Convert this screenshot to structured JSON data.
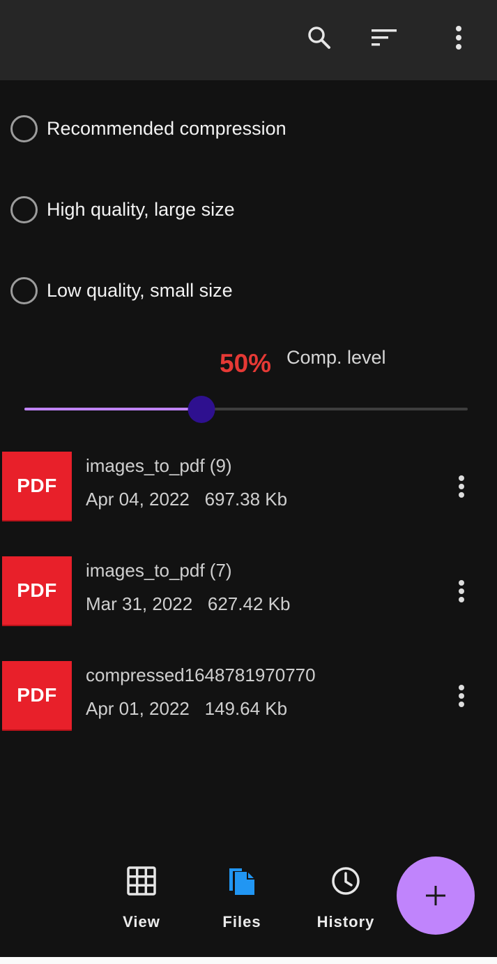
{
  "colors": {
    "accent": "#c084fc",
    "slider_thumb": "#2e108f",
    "percent_red": "#e53935",
    "pdf_red": "#e8202a",
    "files_blue": "#2196f3"
  },
  "toolbar": {
    "icons": [
      "search-icon",
      "sort-icon",
      "more-vert-icon"
    ]
  },
  "compression": {
    "options": [
      {
        "label": "Recommended compression",
        "selected": false
      },
      {
        "label": "High quality, large size",
        "selected": false
      },
      {
        "label": "Low quality, small size",
        "selected": false
      }
    ],
    "percent_text": "50%",
    "level_label": "Comp. level",
    "slider_value": 0.4
  },
  "files": [
    {
      "thumb_label": "PDF",
      "name": "images_to_pdf (9)",
      "date": "Apr 04, 2022",
      "size": "697.38 Kb"
    },
    {
      "thumb_label": "PDF",
      "name": "images_to_pdf (7)",
      "date": "Mar 31, 2022",
      "size": "627.42 Kb"
    },
    {
      "thumb_label": "PDF",
      "name": "compressed1648781970770",
      "date": "Apr 01, 2022",
      "size": "149.64 Kb"
    }
  ],
  "nav": {
    "items": [
      {
        "label": "View",
        "icon": "grid-icon",
        "active": false
      },
      {
        "label": "Files",
        "icon": "files-icon",
        "active": true
      },
      {
        "label": "History",
        "icon": "history-icon",
        "active": false
      }
    ],
    "fab_icon": "plus-icon"
  }
}
